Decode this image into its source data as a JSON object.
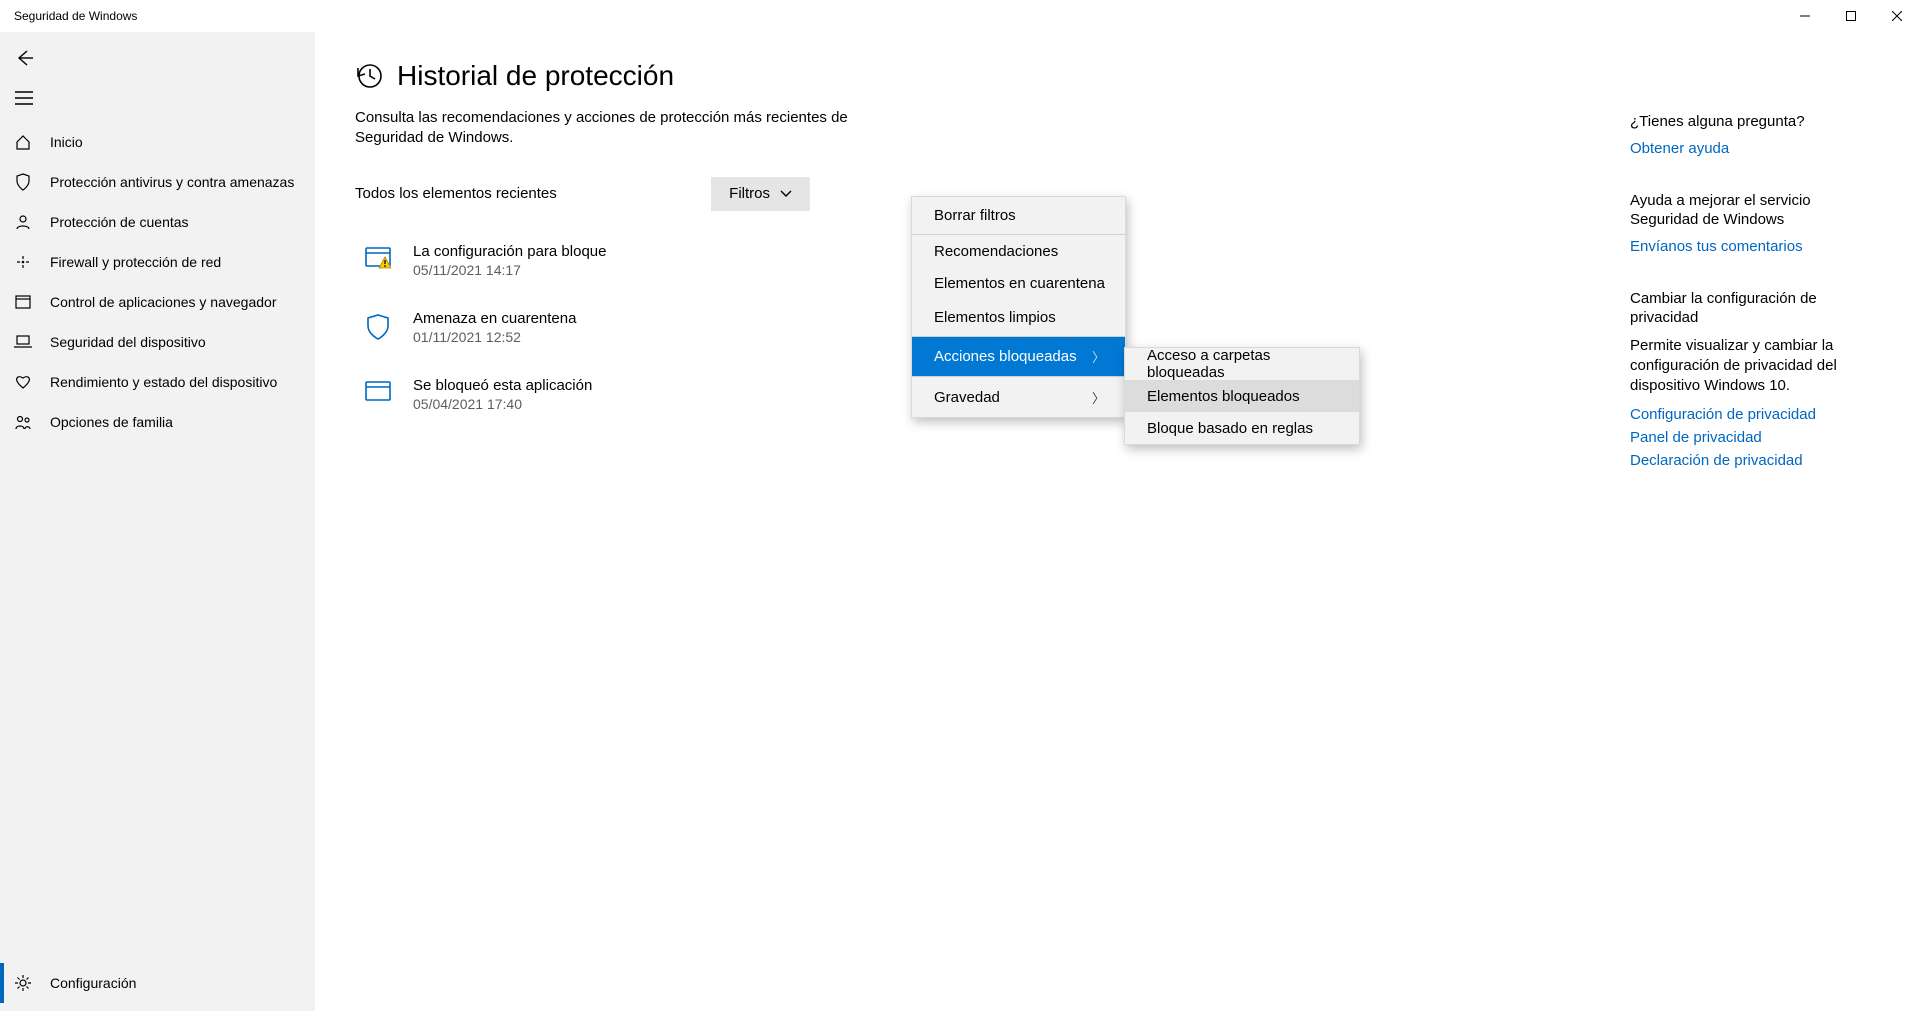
{
  "window": {
    "title": "Seguridad de Windows"
  },
  "sidebar": {
    "items": [
      {
        "label": "Inicio"
      },
      {
        "label": "Protección antivirus y contra amenazas"
      },
      {
        "label": "Protección de cuentas"
      },
      {
        "label": "Firewall y protección de red"
      },
      {
        "label": "Control de aplicaciones y navegador"
      },
      {
        "label": "Seguridad del dispositivo"
      },
      {
        "label": "Rendimiento y estado del dispositivo"
      },
      {
        "label": "Opciones de familia"
      }
    ],
    "settings": "Configuración"
  },
  "page": {
    "title": "Historial de protección",
    "subtitle": "Consulta las recomendaciones y acciones de protección más recientes de Seguridad de Windows.",
    "list_header": "Todos los elementos recientes",
    "filter_label": "Filtros"
  },
  "items": [
    {
      "title": "La configuración para bloque",
      "date": "05/11/2021 14:17"
    },
    {
      "title": "Amenaza en cuarentena",
      "date": "01/11/2021 12:52"
    },
    {
      "title": "Se bloqueó esta aplicación",
      "date": "05/04/2021 17:40"
    }
  ],
  "filter_menu": {
    "clear": "Borrar filtros",
    "recommendations": "Recomendaciones",
    "quarantined": "Elementos en cuarentena",
    "clean": "Elementos limpios",
    "blocked_actions": "Acciones bloqueadas",
    "severity": "Gravedad"
  },
  "submenu": {
    "folder_access": "Acceso a carpetas bloqueadas",
    "blocked_items": "Elementos bloqueados",
    "rule_block": "Bloque basado en reglas"
  },
  "right": {
    "help_title": "¿Tienes alguna pregunta?",
    "help_link": "Obtener ayuda",
    "improve_title": "Ayuda a mejorar el servicio Seguridad de Windows",
    "improve_link": "Envíanos tus comentarios",
    "privacy_title": "Cambiar la configuración de privacidad",
    "privacy_desc": "Permite visualizar y cambiar la configuración de privacidad del dispositivo Windows 10.",
    "privacy_link1": "Configuración de privacidad",
    "privacy_link2": "Panel de privacidad",
    "privacy_link3": "Declaración de privacidad"
  }
}
